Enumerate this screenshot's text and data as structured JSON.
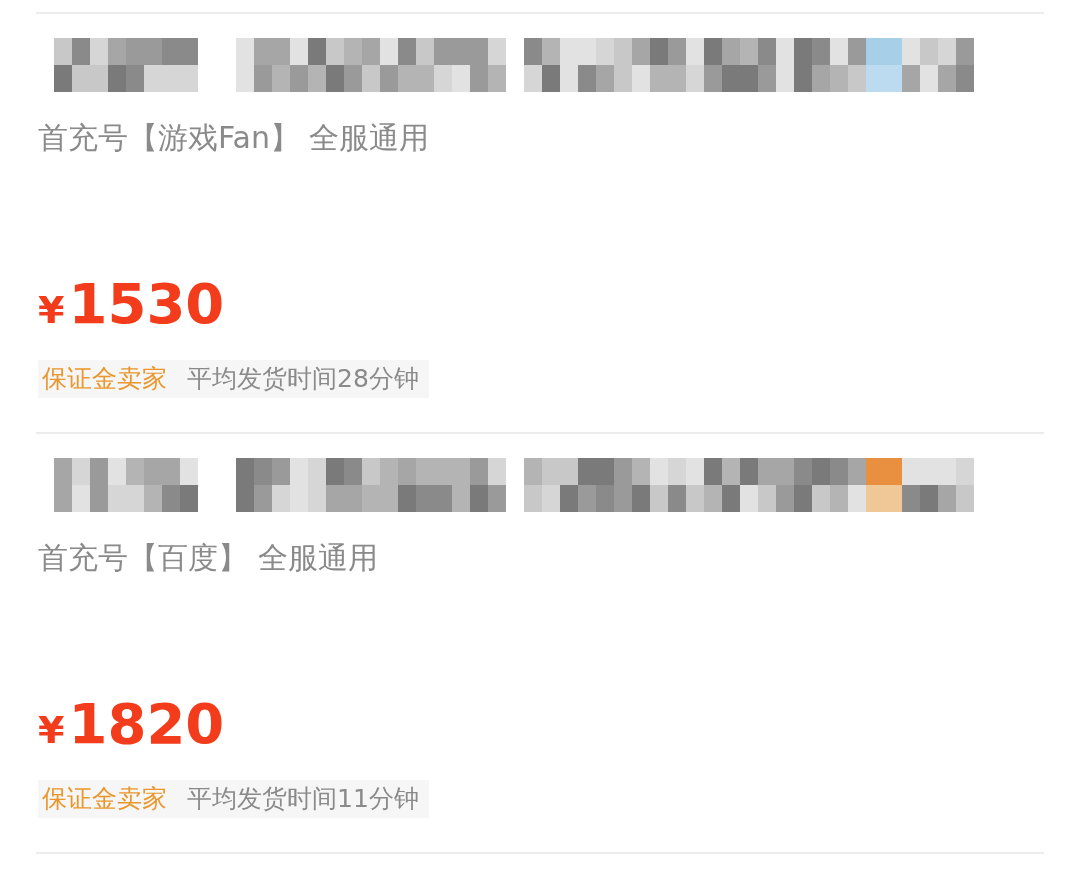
{
  "listings": [
    {
      "subtitle": "首充号【游戏Fan】 全服通用",
      "currency": "¥",
      "price": "1530",
      "badge": "保证金卖家",
      "delivery": "平均发货时间28分钟"
    },
    {
      "subtitle": "首充号【百度】 全服通用",
      "currency": "¥",
      "price": "1820",
      "badge": "保证金卖家",
      "delivery": "平均发货时间11分钟"
    }
  ]
}
